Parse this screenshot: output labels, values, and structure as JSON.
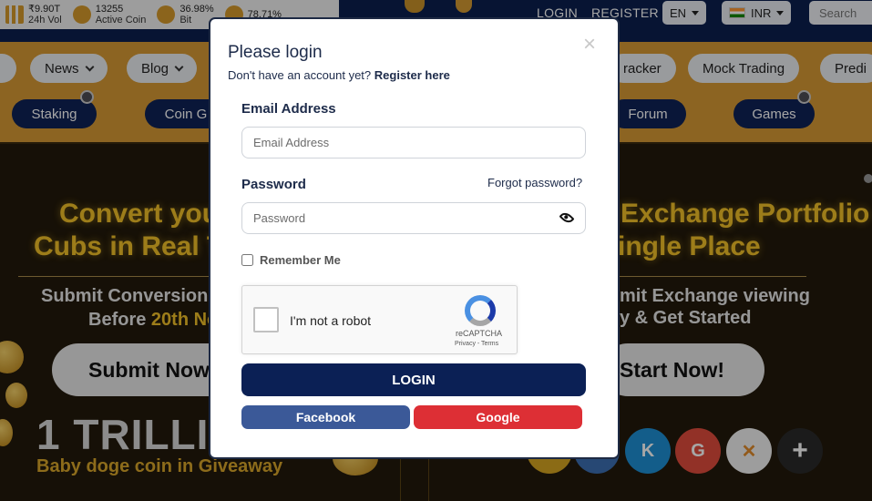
{
  "topbar": {
    "stats": [
      {
        "value": "₹9.90T",
        "label": "24h Vol",
        "icon": "bar-chart-icon"
      },
      {
        "value": "13255",
        "label": "Active Coin",
        "icon": "pie-chart-icon"
      },
      {
        "value": "36.98%",
        "label": "Bit",
        "icon": "bitcoin-icon"
      },
      {
        "value": "78.71%",
        "label": "",
        "icon": "coins-stack-icon"
      }
    ],
    "login_link": "LOGIN",
    "register_link": "REGISTER",
    "language": "EN",
    "currency": "INR",
    "search_placeholder": "Search"
  },
  "nav": {
    "row1": [
      "News",
      "Blog",
      "racker",
      "Mock Trading",
      "Predi"
    ],
    "row2": [
      "Staking",
      "Coin G",
      "Forum",
      "Games"
    ]
  },
  "banner": {
    "left_line1": "Convert you",
    "left_line2": "Cubs in Real T",
    "left_sub1": "Submit Conversion R",
    "left_sub2_pre": "Before ",
    "left_sub2_date": "20th No",
    "left_button": "Submit Now",
    "trillion": "1 TRILLI",
    "doge": "Baby doge coin in Giveaway",
    "right_line1": "Exchange Portfolio at",
    "right_line2": "ingle Place",
    "right_sub1": "mit Exchange viewing",
    "right_sub2": "y & Get Started",
    "right_button": "Start Now!"
  },
  "modal": {
    "title": "Please login",
    "subtitle": "Don't have an account yet?",
    "register_link": "Register here",
    "email_label": "Email Address",
    "email_placeholder": "Email Address",
    "password_label": "Password",
    "forgot": "Forgot password?",
    "password_placeholder": "Password",
    "remember": "Remember Me",
    "captcha_text": "I'm not a robot",
    "captcha_brand": "reCAPTCHA",
    "captcha_links": "Privacy - Terms",
    "login_button": "LOGIN",
    "facebook_button": "Facebook",
    "google_button": "Google",
    "close_symbol": "×"
  },
  "colors": {
    "navy": "#0b2055",
    "gold": "#d79a35",
    "facebook": "#3b5998",
    "google": "#dd2f35"
  }
}
